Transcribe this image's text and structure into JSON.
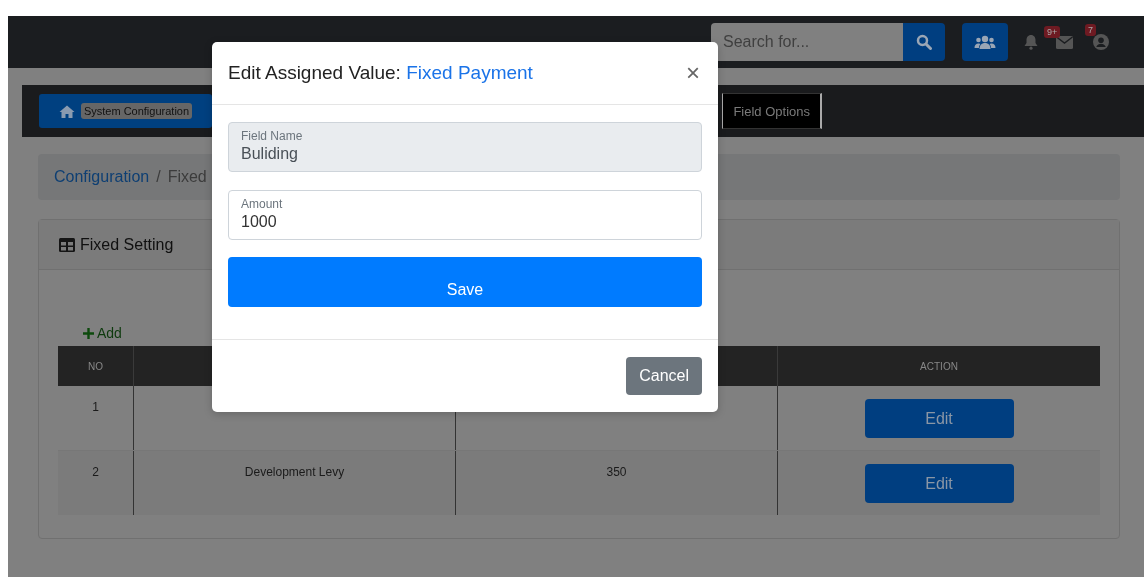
{
  "top_bar": {
    "search": {
      "placeholder": "Search for..."
    },
    "envelope_badge": "9+",
    "user_badge": "7"
  },
  "nav": {
    "items": [
      {
        "label": "System Configuration",
        "selected": true
      },
      {
        "label": "Field Options",
        "selected": false
      }
    ]
  },
  "breadcrumb": {
    "items": [
      "Configuration",
      "Fixed"
    ],
    "separator": "/"
  },
  "card": {
    "title": "Fixed Setting",
    "add_label": "Add",
    "table": {
      "columns": [
        {
          "label": "NO"
        },
        {},
        {},
        {
          "label": "ACTION"
        }
      ],
      "rows": [
        {
          "no": "1",
          "action": "Edit"
        },
        {
          "no": "2",
          "name": "Development Levy",
          "amount": "350",
          "action": "Edit"
        }
      ]
    }
  },
  "modal": {
    "title": "Edit Assigned Value:",
    "title_highlight": "Fixed Payment",
    "close": "×",
    "fields": [
      {
        "label": "Field Name",
        "value": "Buliding",
        "disabled": true
      },
      {
        "label": "Amount",
        "value": "1000",
        "disabled": false
      }
    ],
    "save": "Save",
    "cancel": "Cancel"
  }
}
